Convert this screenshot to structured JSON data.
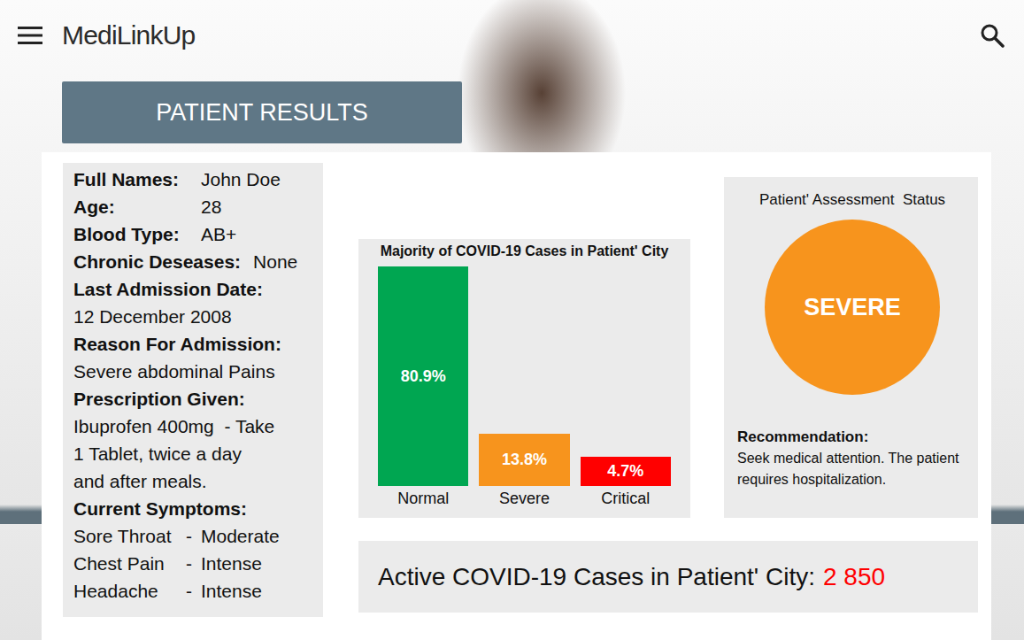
{
  "header": {
    "brand": "MediLinkUp"
  },
  "title": "PATIENT RESULTS",
  "patient": {
    "fields": [
      {
        "label": "Full Names:",
        "value": "John Doe",
        "kind": "inline"
      },
      {
        "label": "Age:",
        "value": "28",
        "kind": "inline"
      },
      {
        "label": "Blood Type:",
        "value": "AB+",
        "kind": "inline"
      },
      {
        "label": "Chronic Deseases:",
        "value": "None",
        "kind": "inline"
      },
      {
        "label": "Last Admission Date:",
        "value": "12 December 2008",
        "kind": "stacked"
      },
      {
        "label": "Reason For Admission:",
        "value": "Severe abdominal Pains",
        "kind": "stacked"
      }
    ],
    "prescription": {
      "label": "Prescription Given:",
      "lines": [
        "Ibuprofen 400mg  - Take",
        "1 Tablet, twice a day",
        "and after meals."
      ]
    },
    "symptoms": {
      "label": "Current Symptoms:",
      "items": [
        {
          "name": "Sore Throat",
          "separator": "-",
          "severity": "Moderate"
        },
        {
          "name": "Chest Pain",
          "separator": "-",
          "severity": "Intense"
        },
        {
          "name": "Headache",
          "separator": "-",
          "severity": "Intense"
        }
      ]
    }
  },
  "chart": {
    "title": "Majority of COVID-19 Cases in Patient' City",
    "bars": [
      {
        "category": "Normal",
        "value": 80.9,
        "value_label": "80.9%",
        "color": "#00a651"
      },
      {
        "category": "Severe",
        "value": 13.8,
        "value_label": "13.8%",
        "color": "#f7941d"
      },
      {
        "category": "Critical",
        "value": 4.7,
        "value_label": "4.7%",
        "color": "#ff0000"
      }
    ]
  },
  "assessment": {
    "title": "Patient' Assessment  Status",
    "status": "SEVERE",
    "recommendation_label": "Recommendation:",
    "recommendation": "Seek medical attention. The patient requires hospitalization."
  },
  "active_cases": {
    "label": "Active COVID-19 Cases in Patient' City:",
    "count": "2 850"
  }
}
